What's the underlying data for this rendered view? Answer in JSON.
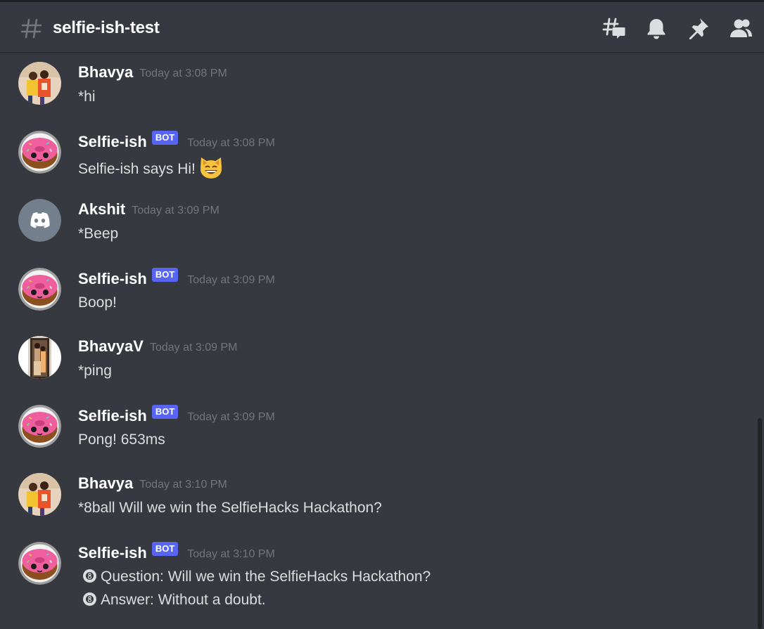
{
  "header": {
    "channel": "selfie-ish-test",
    "icons": [
      "threads-icon",
      "bell-icon",
      "pin-icon",
      "members-icon"
    ]
  },
  "messages": [
    {
      "user": "Bhavya",
      "bot": false,
      "bot_label": "",
      "time": "Today at 3:08 PM",
      "avatar": "photo-two-people",
      "lines": [
        "*hi"
      ]
    },
    {
      "user": "Selfie-ish",
      "bot": true,
      "bot_label": "BOT",
      "time": "Today at 3:08 PM",
      "avatar": "donut",
      "lines": [
        "Selfie-ish says Hi!"
      ],
      "emoji": "smiling-cat-emoji"
    },
    {
      "user": "Akshit",
      "bot": false,
      "bot_label": "",
      "time": "Today at 3:09 PM",
      "avatar": "discord-default",
      "lines": [
        "*Beep"
      ]
    },
    {
      "user": "Selfie-ish",
      "bot": true,
      "bot_label": "BOT",
      "time": "Today at 3:09 PM",
      "avatar": "donut",
      "lines": [
        "Boop!"
      ]
    },
    {
      "user": "BhavyaV",
      "bot": false,
      "bot_label": "",
      "time": "Today at 3:09 PM",
      "avatar": "photo-doorway",
      "lines": [
        "*ping"
      ]
    },
    {
      "user": "Selfie-ish",
      "bot": true,
      "bot_label": "BOT",
      "time": "Today at 3:09 PM",
      "avatar": "donut",
      "lines": [
        "Pong! 653ms"
      ]
    },
    {
      "user": "Bhavya",
      "bot": false,
      "bot_label": "",
      "time": "Today at 3:10 PM",
      "avatar": "photo-two-people",
      "lines": [
        "*8ball Will we win the SelfieHacks Hackathon?"
      ]
    },
    {
      "user": "Selfie-ish",
      "bot": true,
      "bot_label": "BOT",
      "time": "Today at 3:10 PM",
      "avatar": "donut",
      "lines": [
        "Question: Will we win the SelfieHacks Hackathon?",
        "Answer: Without a doubt."
      ],
      "line_icon": "eight-ball-icon"
    }
  ],
  "colors": {
    "background": "#36393f",
    "username": "#ffffff",
    "timestamp": "#72767d",
    "text": "#dcddde",
    "bot_tag": "#5865f2",
    "header_icon": "#dcddde"
  }
}
